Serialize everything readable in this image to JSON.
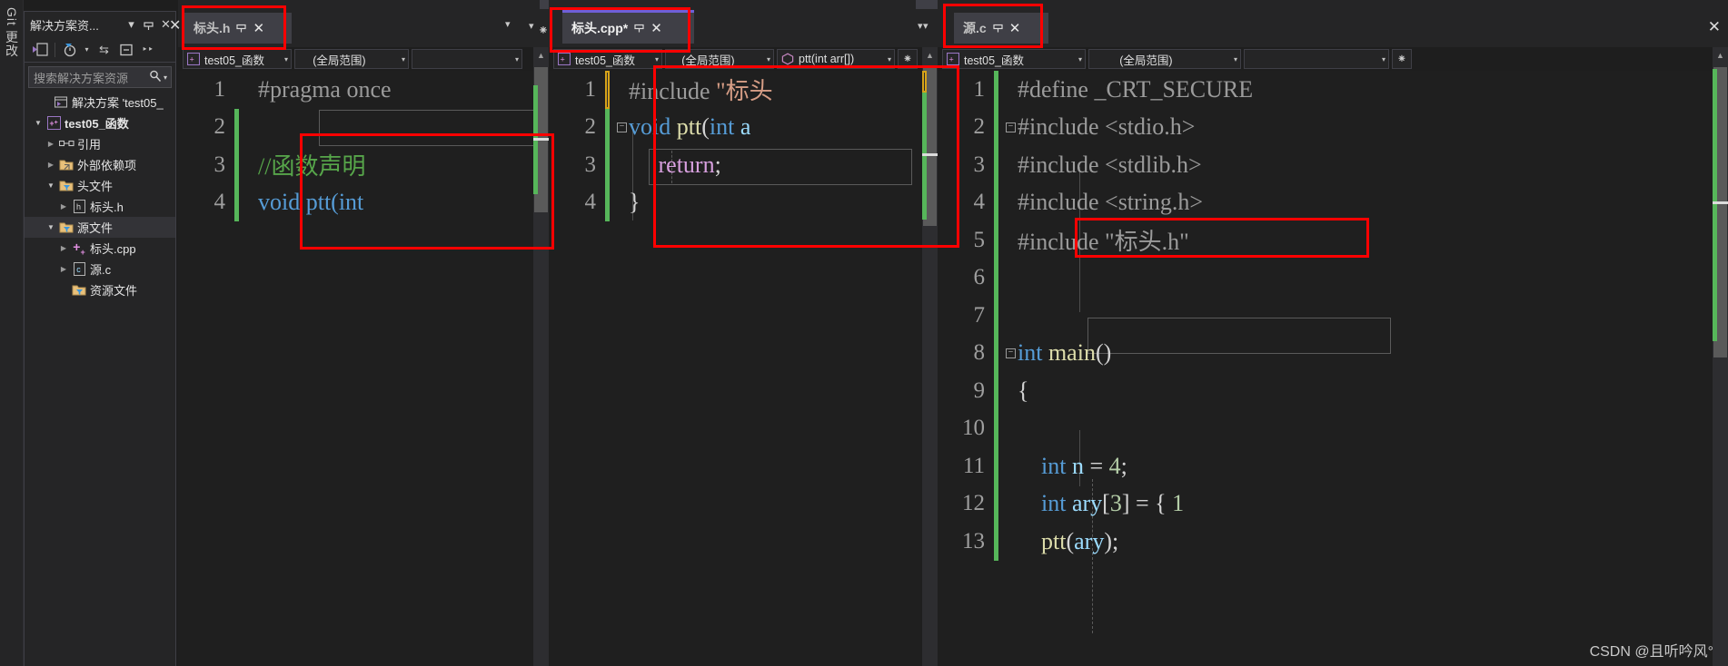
{
  "git_strip": {
    "label": "Git 更改"
  },
  "solution_explorer": {
    "title": "解决方案资...",
    "dropdown_icon": "chevron-down-icon",
    "pin_icon": "pin-icon",
    "close_icon": "close-icon",
    "toolbar": [
      {
        "name": "home-view-icon",
        "glyph": "☷"
      },
      {
        "name": "pending-changes-icon",
        "glyph": "◴"
      },
      {
        "name": "pending-changes-dropdown-icon",
        "glyph": "▼"
      },
      {
        "name": "sync-icon",
        "glyph": "⇆"
      },
      {
        "name": "collapse-all-icon",
        "glyph": "⊟"
      },
      {
        "name": "overflow-icon",
        "glyph": "»"
      }
    ],
    "search": {
      "placeholder": "搜索解决方案资源",
      "icon": "search-icon",
      "dropdown_icon": "chevron-down-icon"
    },
    "tree": [
      {
        "label": "解决方案 'test05_",
        "icon": "solution-icon",
        "indent": 0,
        "arrow": "",
        "bold": false
      },
      {
        "label": "test05_函数",
        "icon": "cpp-project-icon",
        "indent": 1,
        "arrow": "open",
        "bold": true
      },
      {
        "label": "引用",
        "icon": "references-icon",
        "indent": 2,
        "arrow": "closed",
        "bold": false
      },
      {
        "label": "外部依赖项",
        "icon": "ext-deps-icon",
        "indent": 2,
        "arrow": "closed",
        "bold": false
      },
      {
        "label": "头文件",
        "icon": "filter-folder-icon",
        "indent": 2,
        "arrow": "open",
        "bold": false
      },
      {
        "label": "标头.h",
        "icon": "header-file-icon",
        "indent": 3,
        "arrow": "closed",
        "bold": false
      },
      {
        "label": "源文件",
        "icon": "filter-folder-icon",
        "indent": 2,
        "arrow": "open",
        "bold": false,
        "selected": true
      },
      {
        "label": "标头.cpp",
        "icon": "cpp-file-icon",
        "indent": 3,
        "arrow": "closed",
        "bold": false
      },
      {
        "label": "源.c",
        "icon": "c-file-icon",
        "indent": 3,
        "arrow": "closed",
        "bold": false
      },
      {
        "label": "资源文件",
        "icon": "filter-folder-icon",
        "indent": 2,
        "arrow": "",
        "bold": false
      }
    ]
  },
  "panes": [
    {
      "id": "pane-header",
      "tab": {
        "name": "标头.h",
        "active": false,
        "pin_icon": "pin-icon",
        "close_icon": "close-icon"
      },
      "navbar": {
        "project": "test05_函数",
        "scope": "(全局范围)",
        "member": ""
      },
      "lines": [
        {
          "num": "1",
          "change": "none",
          "fold": "",
          "text": "#pragma once",
          "cls": "t-pre"
        },
        {
          "num": "2",
          "change": "green",
          "fold": "",
          "text": "",
          "cls": ""
        },
        {
          "num": "3",
          "change": "green",
          "fold": "",
          "text": "//函数声明",
          "cls": "t-cmt"
        },
        {
          "num": "4",
          "change": "green",
          "fold": "",
          "text": "void ptt(int",
          "cls": ""
        }
      ]
    },
    {
      "id": "pane-cpp",
      "tab": {
        "name": "标头.cpp*",
        "active": true,
        "pin_icon": "pin-icon",
        "close_icon": "close-icon",
        "accent_color": "#6e5fd8"
      },
      "navbar": {
        "project": "test05_函数",
        "scope": "(全局范围)",
        "member": "ptt(int arr[])"
      },
      "lines": [
        {
          "num": "1",
          "change": "orange",
          "fold": "",
          "text": "#include \"标头",
          "cls": ""
        },
        {
          "num": "2",
          "change": "green",
          "fold": "minus",
          "text": "void ptt(int a",
          "cls": ""
        },
        {
          "num": "3",
          "change": "green",
          "fold": "",
          "text": "    return;",
          "cls": ""
        },
        {
          "num": "4",
          "change": "green",
          "fold": "",
          "text": "}",
          "cls": "t-punc"
        }
      ]
    },
    {
      "id": "pane-c",
      "tab": {
        "name": "源.c",
        "active": false,
        "pin_icon": "pin-icon",
        "close_icon": "close-icon"
      },
      "navbar": {
        "project": "test05_函数",
        "scope": "(全局范围)",
        "member": ""
      },
      "lines": [
        {
          "num": "1",
          "change": "green",
          "fold": "",
          "text": "#define _CRT_SECURE",
          "cls": "t-pre"
        },
        {
          "num": "2",
          "change": "green",
          "fold": "minus",
          "text": "#include <stdio.h>",
          "cls": "t-pre"
        },
        {
          "num": "3",
          "change": "green",
          "fold": "",
          "text": "#include <stdlib.h>",
          "cls": "t-pre"
        },
        {
          "num": "4",
          "change": "green",
          "fold": "",
          "text": "#include <string.h>",
          "cls": "t-pre"
        },
        {
          "num": "5",
          "change": "green",
          "fold": "",
          "text": "#include \"标头.h\"",
          "cls": ""
        },
        {
          "num": "6",
          "change": "green",
          "fold": "",
          "text": "",
          "cls": ""
        },
        {
          "num": "7",
          "change": "green",
          "fold": "",
          "text": "",
          "cls": ""
        },
        {
          "num": "8",
          "change": "green",
          "fold": "minus",
          "text": "int main()",
          "cls": ""
        },
        {
          "num": "9",
          "change": "green",
          "fold": "",
          "text": "{",
          "cls": "t-punc"
        },
        {
          "num": "10",
          "change": "green",
          "fold": "",
          "text": "",
          "cls": ""
        },
        {
          "num": "11",
          "change": "green",
          "fold": "",
          "text": "    int n = 4;",
          "cls": ""
        },
        {
          "num": "12",
          "change": "green",
          "fold": "",
          "text": "    int ary[3] = { 1",
          "cls": ""
        },
        {
          "num": "13",
          "change": "green",
          "fold": "",
          "text": "    ptt(ary);",
          "cls": ""
        }
      ]
    }
  ],
  "watermark": "CSDN @且听吟风°",
  "colors": {
    "annotation_red": "#ff0000",
    "change_green": "#56b65a",
    "change_orange": "#d6a319",
    "tab_accent": "#6e5fd8",
    "editor_bg": "#1f1f1f",
    "chrome_bg": "#252526"
  }
}
